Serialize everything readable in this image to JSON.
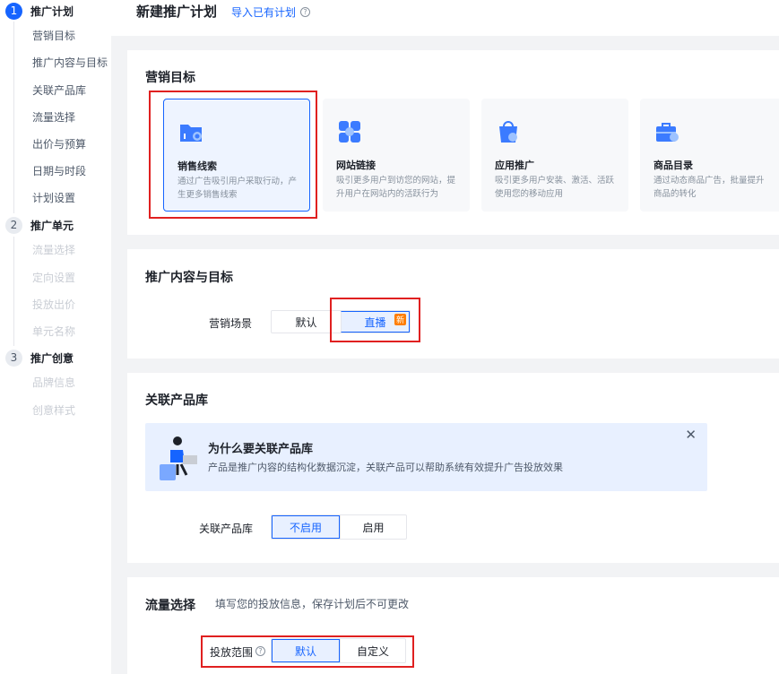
{
  "sidebar": {
    "steps": [
      {
        "num": "1",
        "label": "推广计划",
        "items": [
          "营销目标",
          "推广内容与目标",
          "关联产品库",
          "流量选择",
          "出价与预算",
          "日期与时段",
          "计划设置"
        ]
      },
      {
        "num": "2",
        "label": "推广单元",
        "items": [
          "流量选择",
          "定向设置",
          "投放出价",
          "单元名称"
        ]
      },
      {
        "num": "3",
        "label": "推广创意",
        "items": [
          "品牌信息",
          "创意样式"
        ]
      }
    ]
  },
  "header": {
    "title": "新建推广计划",
    "import_link": "导入已有计划",
    "help_icon": "question-circle-icon"
  },
  "goals_section": {
    "title": "营销目标",
    "options": [
      {
        "name": "销售线索",
        "desc": "通过广告吸引用户采取行动，产生更多销售线索",
        "icon": "folder-search-icon",
        "selected": true
      },
      {
        "name": "网站链接",
        "desc": "吸引更多用户到访您的网站，提升用户在网站内的活跃行为",
        "icon": "link-grid-icon",
        "selected": false
      },
      {
        "name": "应用推广",
        "desc": "吸引更多用户安装、激活、活跃使用您的移动应用",
        "icon": "app-bag-icon",
        "selected": false
      },
      {
        "name": "商品目录",
        "desc": "通过动态商品广告，批量提升商品的转化",
        "icon": "briefcase-icon",
        "selected": false
      }
    ]
  },
  "content_section": {
    "title": "推广内容与目标",
    "scene_label": "营销场景",
    "options": [
      "默认",
      "直播"
    ],
    "selected": "直播",
    "new_badge": "新"
  },
  "product_section": {
    "title": "关联产品库",
    "banner_title": "为什么要关联产品库",
    "banner_desc": "产品是推广内容的结构化数据沉淀，关联产品可以帮助系统有效提升广告投放效果",
    "close_icon": "close-icon",
    "field_label": "关联产品库",
    "options": [
      "不启用",
      "启用"
    ],
    "selected": "不启用"
  },
  "traffic_section": {
    "title": "流量选择",
    "hint": "填写您的投放信息，保存计划后不可更改",
    "field_label": "投放范围",
    "options": [
      "默认",
      "自定义"
    ],
    "selected": "默认"
  },
  "colors": {
    "primary": "#1664ff",
    "highlight": "#e02020",
    "badge": "#ff7d00"
  }
}
